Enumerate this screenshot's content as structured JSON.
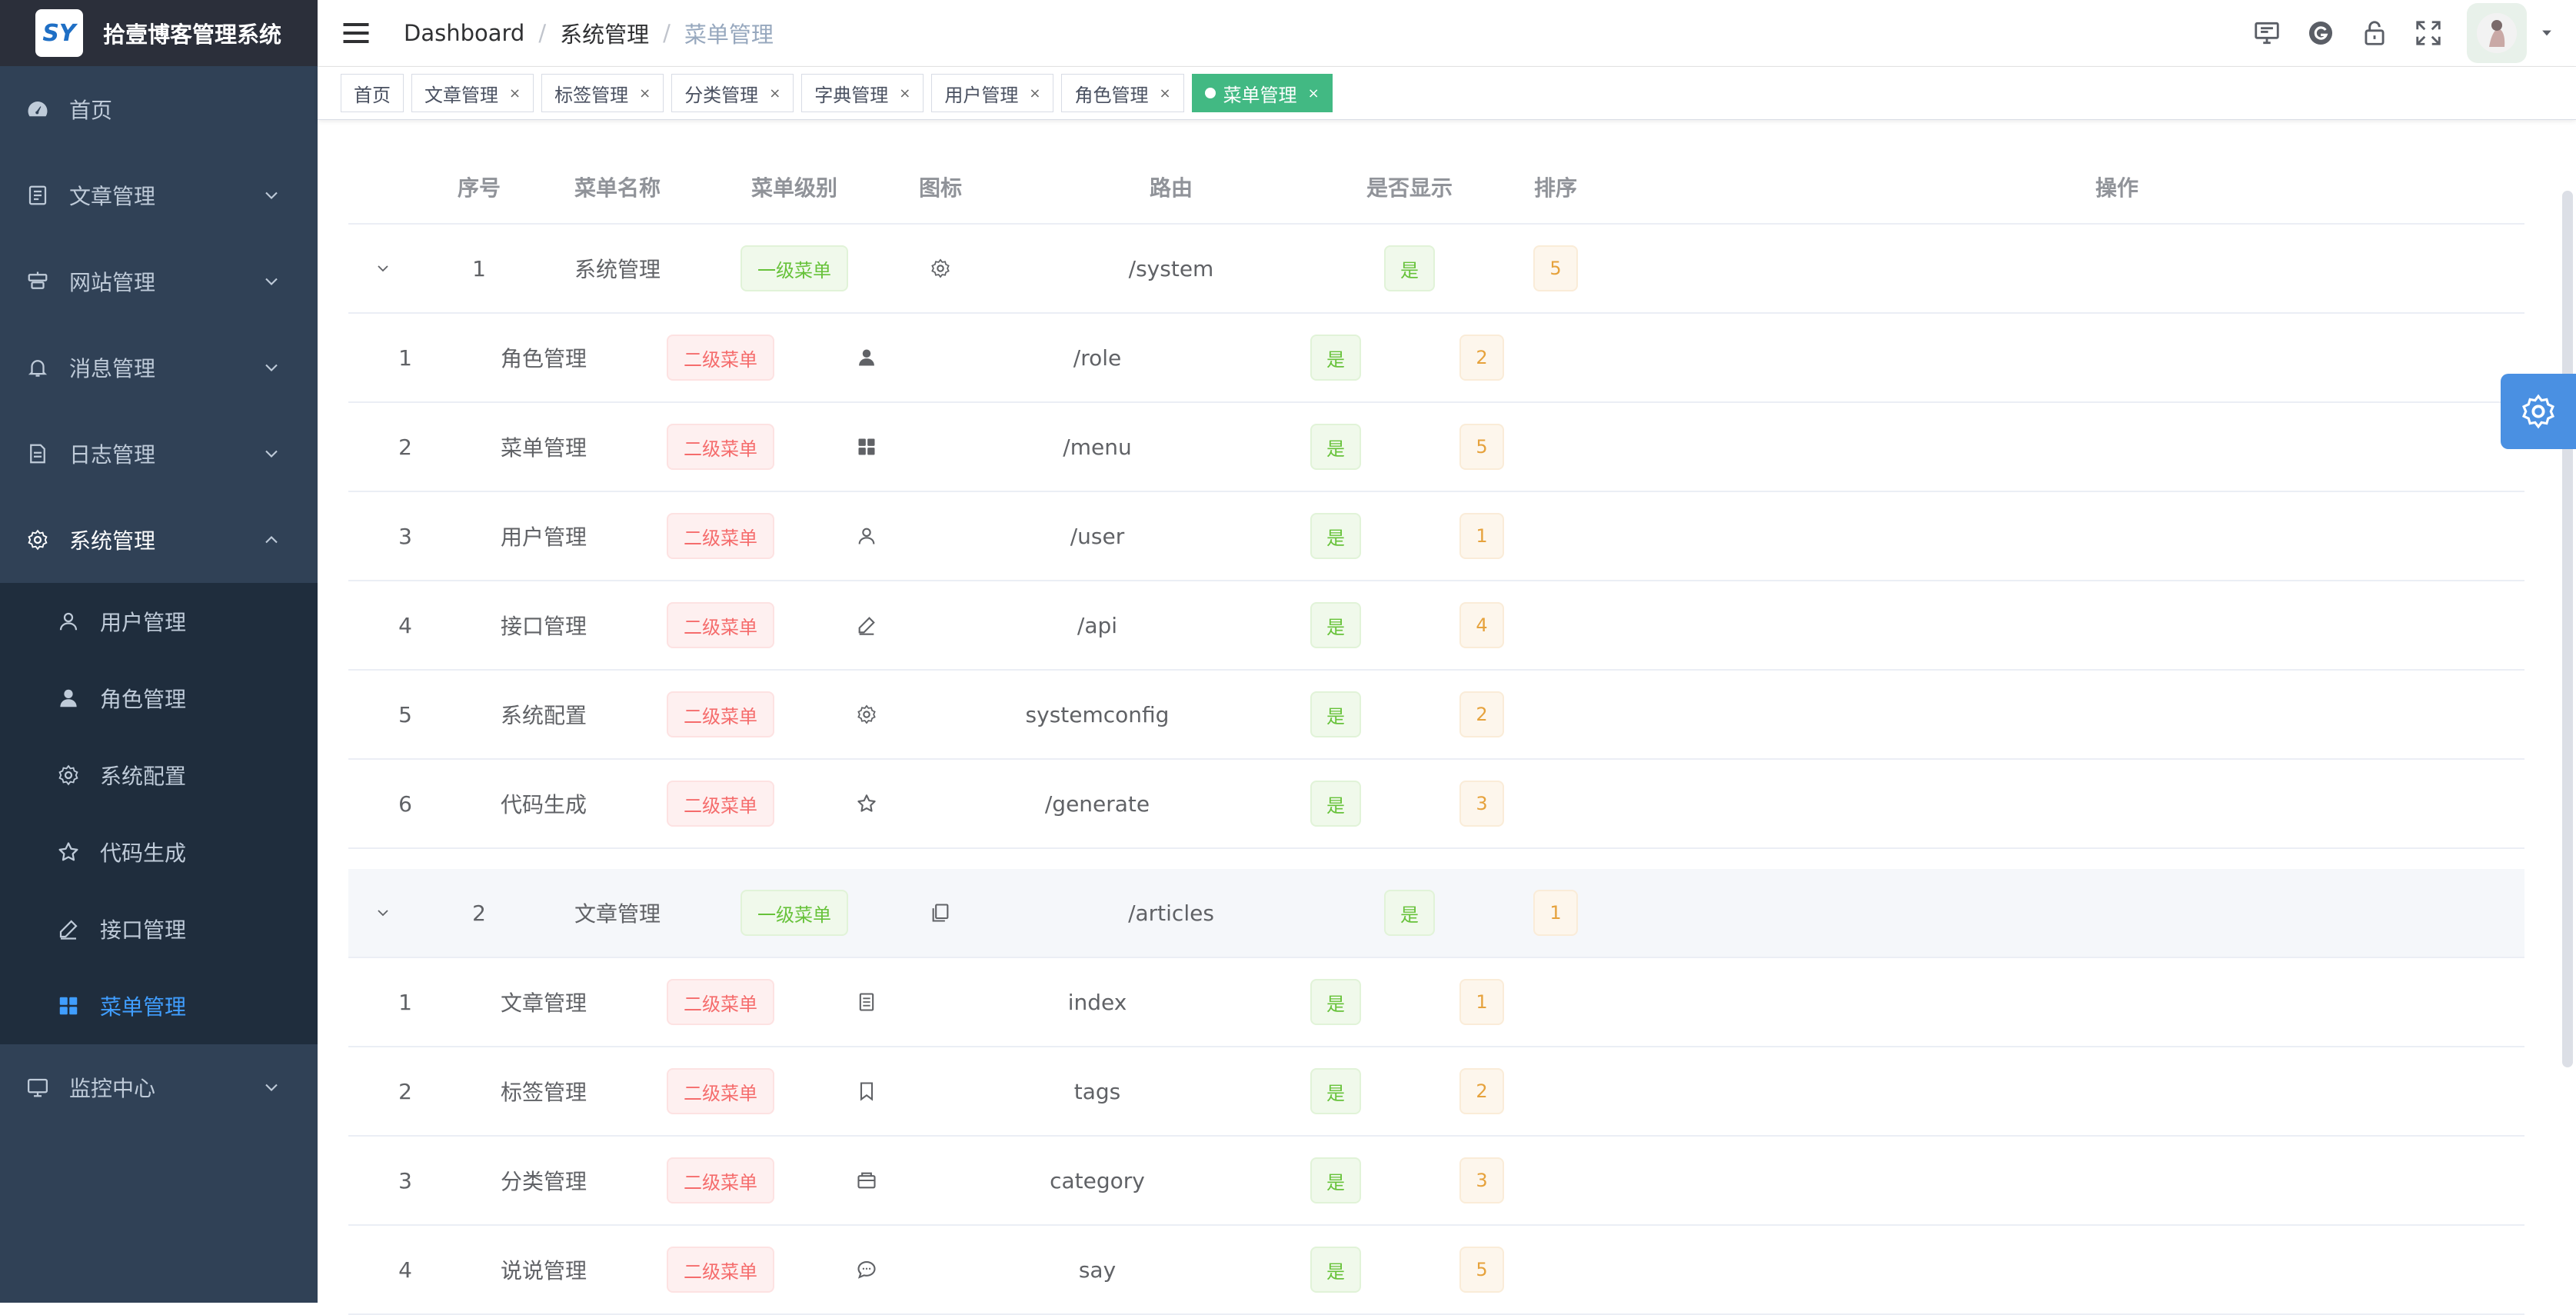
{
  "app": {
    "title": "拾壹博客管理系统",
    "logo_text": "SY"
  },
  "sidebar": {
    "items": [
      {
        "label": "首页",
        "icon": "dashboard-icon",
        "has_children": false
      },
      {
        "label": "文章管理",
        "icon": "document-icon",
        "has_children": true
      },
      {
        "label": "网站管理",
        "icon": "website-icon",
        "has_children": true
      },
      {
        "label": "消息管理",
        "icon": "bell-icon",
        "has_children": true
      },
      {
        "label": "日志管理",
        "icon": "log-icon",
        "has_children": true
      },
      {
        "label": "系统管理",
        "icon": "gear-icon",
        "has_children": true,
        "expanded": true
      },
      {
        "label": "监控中心",
        "icon": "monitor-icon",
        "has_children": true
      }
    ],
    "system_children": [
      {
        "label": "用户管理",
        "icon": "user-icon"
      },
      {
        "label": "角色管理",
        "icon": "person-icon"
      },
      {
        "label": "系统配置",
        "icon": "gear-icon"
      },
      {
        "label": "代码生成",
        "icon": "star-icon"
      },
      {
        "label": "接口管理",
        "icon": "edit-icon"
      },
      {
        "label": "菜单管理",
        "icon": "grid-icon",
        "active": true
      }
    ]
  },
  "breadcrumb": [
    "Dashboard",
    "系统管理",
    "菜单管理"
  ],
  "tags": [
    {
      "label": "首页",
      "closable": false,
      "active": false
    },
    {
      "label": "文章管理",
      "closable": true,
      "active": false
    },
    {
      "label": "标签管理",
      "closable": true,
      "active": false
    },
    {
      "label": "分类管理",
      "closable": true,
      "active": false
    },
    {
      "label": "字典管理",
      "closable": true,
      "active": false
    },
    {
      "label": "用户管理",
      "closable": true,
      "active": false
    },
    {
      "label": "角色管理",
      "closable": true,
      "active": false
    },
    {
      "label": "菜单管理",
      "closable": true,
      "active": true
    }
  ],
  "table": {
    "headers": [
      "序号",
      "菜单名称",
      "菜单级别",
      "图标",
      "路由",
      "是否显示",
      "排序",
      "操作"
    ],
    "rows": [
      {
        "type": "parent",
        "index": "1",
        "name": "系统管理",
        "level": "一级菜单",
        "icon": "gear-icon",
        "route": "/system",
        "show": "是",
        "sort": "5"
      },
      {
        "type": "child",
        "index": "1",
        "name": "角色管理",
        "level": "二级菜单",
        "icon": "person-icon",
        "route": "/role",
        "show": "是",
        "sort": "2"
      },
      {
        "type": "child",
        "index": "2",
        "name": "菜单管理",
        "level": "二级菜单",
        "icon": "grid-icon",
        "route": "/menu",
        "show": "是",
        "sort": "5"
      },
      {
        "type": "child",
        "index": "3",
        "name": "用户管理",
        "level": "二级菜单",
        "icon": "user-icon",
        "route": "/user",
        "show": "是",
        "sort": "1"
      },
      {
        "type": "child",
        "index": "4",
        "name": "接口管理",
        "level": "二级菜单",
        "icon": "edit-icon",
        "route": "/api",
        "show": "是",
        "sort": "4"
      },
      {
        "type": "child",
        "index": "5",
        "name": "系统配置",
        "level": "二级菜单",
        "icon": "gear-icon",
        "route": "systemconfig",
        "show": "是",
        "sort": "2"
      },
      {
        "type": "child",
        "index": "6",
        "name": "代码生成",
        "level": "二级菜单",
        "icon": "star-icon",
        "route": "/generate",
        "show": "是",
        "sort": "3"
      },
      {
        "type": "parent",
        "index": "2",
        "name": "文章管理",
        "level": "一级菜单",
        "icon": "document-icon",
        "route": "/articles",
        "show": "是",
        "sort": "1",
        "highlight": true
      },
      {
        "type": "child",
        "index": "1",
        "name": "文章管理",
        "level": "二级菜单",
        "icon": "article-icon",
        "route": "index",
        "show": "是",
        "sort": "1"
      },
      {
        "type": "child",
        "index": "2",
        "name": "标签管理",
        "level": "二级菜单",
        "icon": "bookmark-icon",
        "route": "tags",
        "show": "是",
        "sort": "2"
      },
      {
        "type": "child",
        "index": "3",
        "name": "分类管理",
        "level": "二级菜单",
        "icon": "folder-icon",
        "route": "category",
        "show": "是",
        "sort": "3"
      },
      {
        "type": "child",
        "index": "4",
        "name": "说说管理",
        "level": "二级菜单",
        "icon": "chat-icon",
        "route": "say",
        "show": "是",
        "sort": "5"
      }
    ]
  },
  "colors": {
    "sidebar_bg": "#304156",
    "accent": "#409eff",
    "active_tag": "#42b983"
  }
}
